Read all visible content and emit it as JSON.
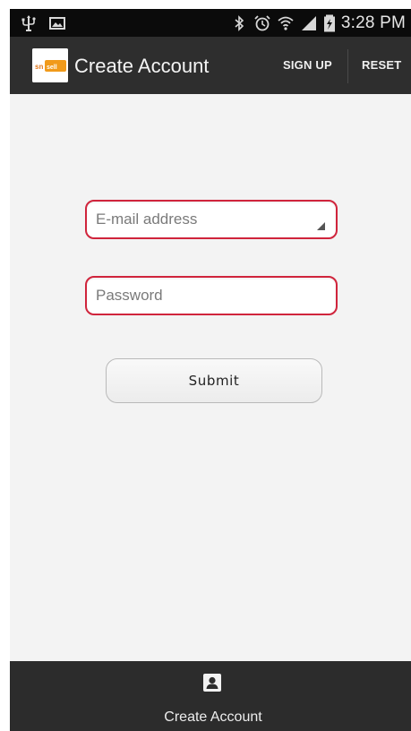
{
  "status_bar": {
    "time": "3:28 PM",
    "icons": [
      "usb-icon",
      "image-icon",
      "bluetooth-icon",
      "alarm-icon",
      "wifi-icon",
      "signal-icon",
      "battery-icon"
    ]
  },
  "action_bar": {
    "logo_text": "snapsell",
    "title": "Create Account",
    "sign_up_label": "SIGN UP",
    "reset_label": "RESET"
  },
  "form": {
    "email_placeholder": "E-mail address",
    "password_placeholder": "Password",
    "submit_label": "Submit"
  },
  "bottom_bar": {
    "tab_label": "Create Account",
    "tab_icon": "account-icon"
  },
  "colors": {
    "field_border": "#d0243c",
    "action_bar": "#2e2e2e",
    "status_bar": "#0b0b0b",
    "background": "#f3f3f3"
  }
}
